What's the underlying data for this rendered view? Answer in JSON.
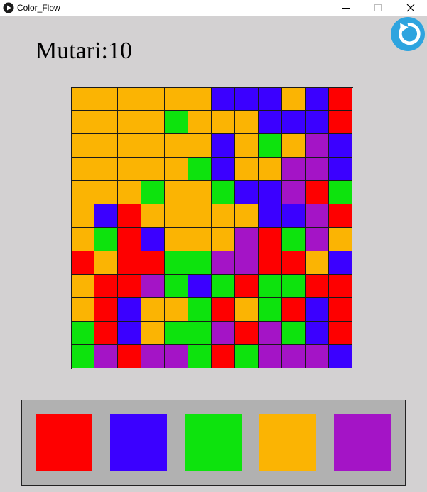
{
  "window": {
    "title": "Color_Flow",
    "controls": [
      "minimize",
      "maximize",
      "close"
    ]
  },
  "header": {
    "moves_text": "Mutari:10"
  },
  "restart_icon": "restart-arrow-icon",
  "colors": {
    "R": "#fe0000",
    "B": "#3b00ff",
    "G": "#0de30d",
    "O": "#fbb403",
    "P": "#a414c6"
  },
  "board": {
    "rows": 12,
    "cols": 12,
    "cells": [
      "OOOOOOBBBOBR",
      "OOOOGOOOBBBR",
      "OOOOOOBOGOPB",
      "OOOOOGBOOPPB",
      "OOOGOOGBBPRG",
      "OBROOOOOBBPR",
      "OGRBOOOPRGPO",
      "RORRGGPPRROB",
      "ORRPGBGRGGRR",
      "ORBOOGROGRBR",
      "GRBOGGPRPGBR",
      "GPRPPGRGPPPB"
    ]
  },
  "palette": [
    {
      "name": "red",
      "color": "#fe0000"
    },
    {
      "name": "blue",
      "color": "#3b00ff"
    },
    {
      "name": "green",
      "color": "#0de30d"
    },
    {
      "name": "orange",
      "color": "#fbb403"
    },
    {
      "name": "purple",
      "color": "#a414c6"
    }
  ]
}
